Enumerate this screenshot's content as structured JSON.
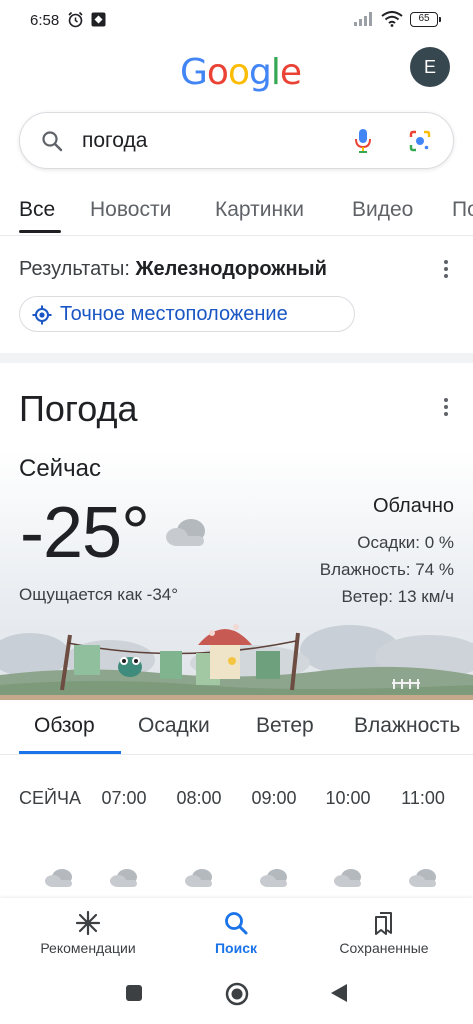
{
  "status_bar": {
    "time": "6:58",
    "battery": "65",
    "icons": [
      "alarm-icon",
      "app-notification-icon",
      "signal-icon",
      "wifi-icon",
      "battery-icon"
    ]
  },
  "header": {
    "logo_text": "Google",
    "logo_colors": [
      "#4285F4",
      "#EA4335",
      "#FBBC05",
      "#4285F4",
      "#34A853",
      "#EA4335"
    ],
    "avatar_letter": "E"
  },
  "search": {
    "query": "погода"
  },
  "tabs": [
    {
      "label": "Все",
      "active": true
    },
    {
      "label": "Новости"
    },
    {
      "label": "Картинки"
    },
    {
      "label": "Видео"
    },
    {
      "label": "По"
    }
  ],
  "results": {
    "prefix": "Результаты: ",
    "location": "Железнодорожный",
    "precise_location_label": "Точное местоположение"
  },
  "weather": {
    "title": "Погода",
    "now_label": "Сейчас",
    "temperature": "-25°",
    "feels_like": "Ощущается как -34°",
    "condition": "Облачно",
    "precipitation": "Осадки: 0 %",
    "humidity": "Влажность: 74 %",
    "wind": "Ветер: 13 км/ч",
    "accent_color": "#1a73e8"
  },
  "forecast_tabs": [
    {
      "label": "Обзор",
      "active": true
    },
    {
      "label": "Осадки"
    },
    {
      "label": "Ветер"
    },
    {
      "label": "Влажность"
    }
  ],
  "hours": [
    "СЕЙЧАС",
    "07:00",
    "08:00",
    "09:00",
    "10:00",
    "11:00"
  ],
  "hour_icons": [
    "cloud-icon",
    "cloud-icon",
    "cloud-icon",
    "cloud-icon",
    "cloud-icon",
    "cloud-icon"
  ],
  "bottom_nav": [
    {
      "label": "Рекомендации",
      "icon": "asterisk-icon"
    },
    {
      "label": "Поиск",
      "icon": "search-icon",
      "active": true
    },
    {
      "label": "Сохраненные",
      "icon": "bookmarks-icon"
    }
  ],
  "system_nav": [
    "recents-button",
    "home-button",
    "back-button"
  ]
}
